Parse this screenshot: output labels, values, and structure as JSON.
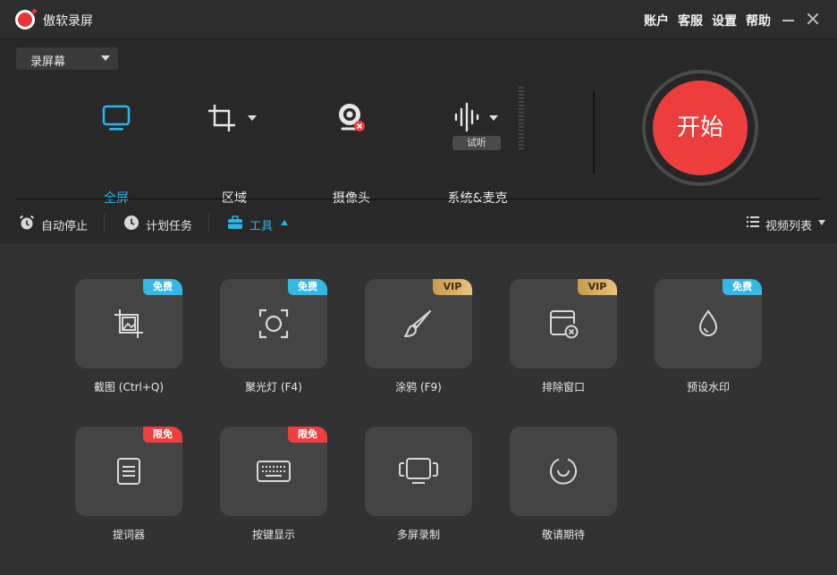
{
  "app": {
    "title": "傲软录屏"
  },
  "top_menu": [
    {
      "label": "账户"
    },
    {
      "label": "客服"
    },
    {
      "label": "设置"
    },
    {
      "label": "帮助"
    }
  ],
  "mode_select": {
    "value": "录屏幕"
  },
  "sources": [
    {
      "label": "全屏",
      "active": true,
      "icon": "monitor-icon"
    },
    {
      "label": "区域",
      "active": false,
      "icon": "crop-icon"
    },
    {
      "label": "摄像头",
      "active": false,
      "icon": "webcam-icon"
    },
    {
      "label": "系统&麦克",
      "active": false,
      "icon": "audio-wave-icon",
      "badge": "试听"
    }
  ],
  "start_button": {
    "label": "开始"
  },
  "toolbar": {
    "auto_stop": "自动停止",
    "schedule": "计划任务",
    "tools": "工具",
    "video_list": "视频列表"
  },
  "tools": [
    {
      "label": "截图 (Ctrl+Q)",
      "badge": "免费",
      "badge_type": "free",
      "icon": "screenshot-icon"
    },
    {
      "label": "聚光灯 (F4)",
      "badge": "免费",
      "badge_type": "free",
      "icon": "spotlight-icon"
    },
    {
      "label": "涂鸦 (F9)",
      "badge": "VIP",
      "badge_type": "vip",
      "icon": "brush-icon"
    },
    {
      "label": "排除窗口",
      "badge": "VIP",
      "badge_type": "vip",
      "icon": "exclude-window-icon"
    },
    {
      "label": "预设水印",
      "badge": "免费",
      "badge_type": "free",
      "icon": "watermark-drop-icon"
    },
    {
      "label": "提词器",
      "badge": "限免",
      "badge_type": "limited",
      "icon": "teleprompter-icon"
    },
    {
      "label": "按键显示",
      "badge": "限免",
      "badge_type": "limited",
      "icon": "keyboard-icon"
    },
    {
      "label": "多屏录制",
      "badge": "",
      "badge_type": "",
      "icon": "multi-screen-icon"
    },
    {
      "label": "敬请期待",
      "badge": "",
      "badge_type": "",
      "icon": "smile-icon"
    }
  ],
  "colors": {
    "accent": "#2bb3e8",
    "record_red": "#ee3d3d",
    "badge_free": "#36b8e6",
    "badge_vip": "#d9b064",
    "badge_limited": "#ef3e3e"
  }
}
